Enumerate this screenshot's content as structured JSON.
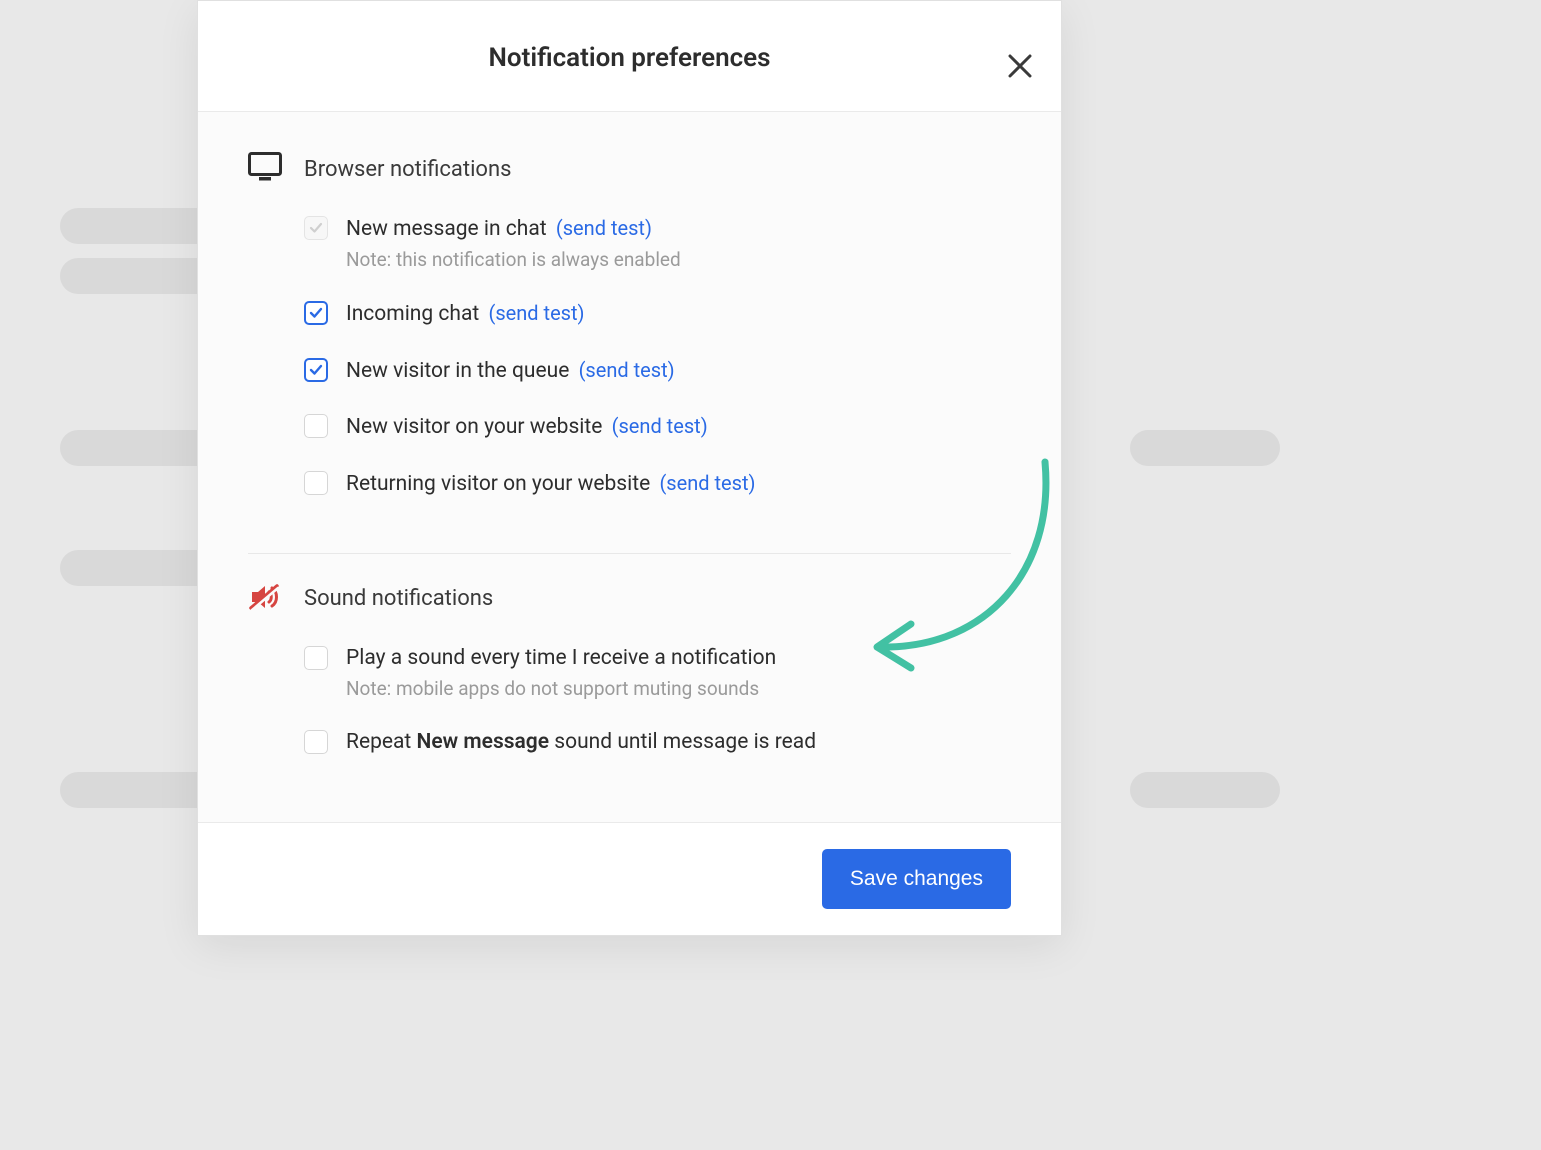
{
  "modal": {
    "title": "Notification preferences"
  },
  "browser": {
    "heading": "Browser notifications",
    "items": {
      "new_message": {
        "label": "New message in chat",
        "send_test": "(send test)",
        "note": "Note: this notification is always enabled"
      },
      "incoming_chat": {
        "label": "Incoming chat",
        "send_test": "(send test)"
      },
      "new_visitor_queue": {
        "label": "New visitor in the queue",
        "send_test": "(send test)"
      },
      "new_visitor_site": {
        "label": "New visitor on your website",
        "send_test": "(send test)"
      },
      "returning_visitor": {
        "label": "Returning visitor on your website",
        "send_test": "(send test)"
      }
    }
  },
  "sound": {
    "heading": "Sound notifications",
    "items": {
      "play_sound": {
        "label": "Play a sound every time I receive a notification",
        "note": "Note: mobile apps do not support muting sounds"
      },
      "repeat": {
        "prefix": "Repeat ",
        "bold": "New message",
        "suffix": " sound until message is read"
      }
    }
  },
  "footer": {
    "save_label": "Save changes"
  }
}
